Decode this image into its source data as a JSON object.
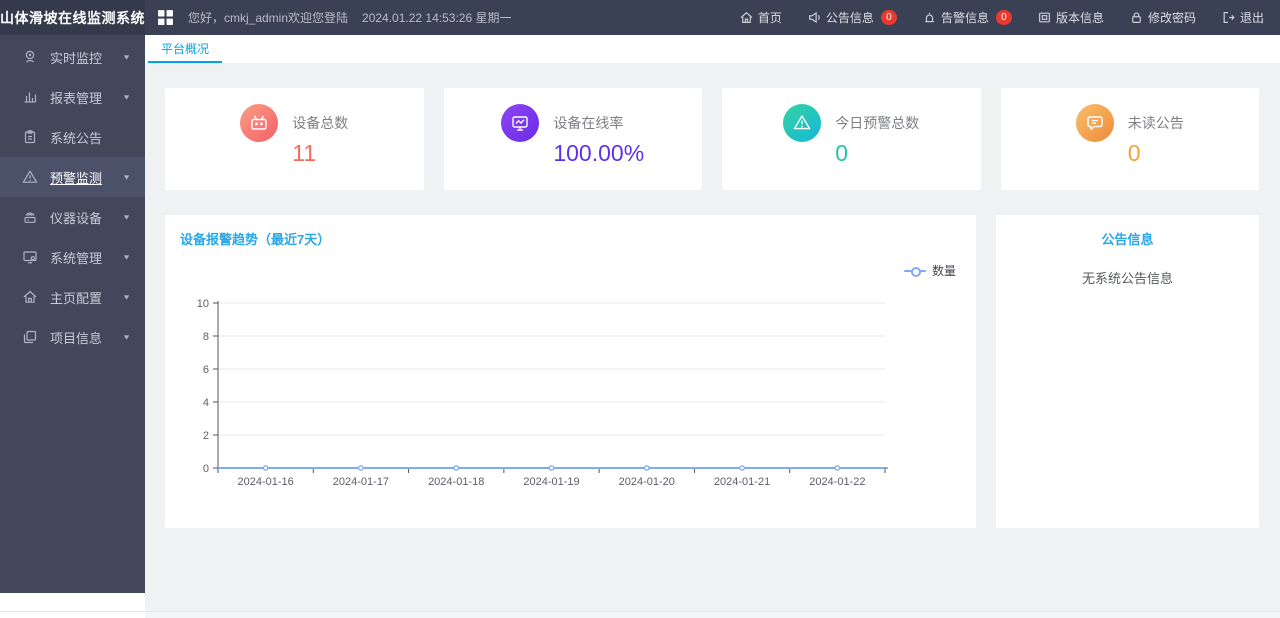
{
  "app": {
    "title": "山体滑坡在线监测系统"
  },
  "header": {
    "greeting": "您好，cmkj_admin欢迎您登陆",
    "datetime": "2024.01.22 14:53:26 星期一",
    "nav": [
      {
        "label": "首页",
        "icon": "home-icon"
      },
      {
        "label": "公告信息",
        "icon": "announcement-icon",
        "badge": "0"
      },
      {
        "label": "告警信息",
        "icon": "alarm-icon",
        "badge": "0"
      },
      {
        "label": "版本信息",
        "icon": "version-icon"
      },
      {
        "label": "修改密码",
        "icon": "password-icon"
      },
      {
        "label": "退出",
        "icon": "logout-icon"
      }
    ]
  },
  "sidebar": {
    "items": [
      {
        "label": "实时监控",
        "icon": "webcam-icon",
        "expandable": true,
        "active": false
      },
      {
        "label": "报表管理",
        "icon": "report-icon",
        "expandable": true,
        "active": false
      },
      {
        "label": "系统公告",
        "icon": "notice-icon",
        "expandable": false,
        "active": false
      },
      {
        "label": "预警监测",
        "icon": "warning-icon",
        "expandable": true,
        "active": true
      },
      {
        "label": "仪器设备",
        "icon": "instrument-icon",
        "expandable": true,
        "active": false
      },
      {
        "label": "系统管理",
        "icon": "system-icon",
        "expandable": true,
        "active": false
      },
      {
        "label": "主页配置",
        "icon": "homepage-icon",
        "expandable": true,
        "active": false
      },
      {
        "label": "项目信息",
        "icon": "project-icon",
        "expandable": true,
        "active": false
      }
    ]
  },
  "tabs": [
    {
      "label": "平台概况",
      "active": true
    }
  ],
  "stats": [
    {
      "label": "设备总数",
      "value": "11",
      "value_color": "#f56c5b",
      "icon": "device-total-icon",
      "icon_gradient": [
        "#fa9d85",
        "#f55f68"
      ]
    },
    {
      "label": "设备在线率",
      "value": "100.00%",
      "value_color": "#5f30f2",
      "icon": "online-rate-icon",
      "icon_gradient": [
        "#8d46f2",
        "#6a2be8"
      ]
    },
    {
      "label": "今日预警总数",
      "value": "0",
      "value_color": "#25c3a6",
      "icon": "today-warning-icon",
      "icon_gradient": [
        "#35d3a2",
        "#14b8d8"
      ]
    },
    {
      "label": "未读公告",
      "value": "0",
      "value_color": "#f2a33d",
      "icon": "unread-notice-icon",
      "icon_gradient": [
        "#f8c06a",
        "#ee8a3a"
      ]
    }
  ],
  "chart_data": {
    "type": "line",
    "title": "设备报警趋势（最近7天）",
    "categories": [
      "2024-01-16",
      "2024-01-17",
      "2024-01-18",
      "2024-01-19",
      "2024-01-20",
      "2024-01-21",
      "2024-01-22"
    ],
    "series": [
      {
        "name": "数量",
        "values": [
          0,
          0,
          0,
          0,
          0,
          0,
          0
        ]
      }
    ],
    "ylim": [
      0,
      10
    ],
    "ytick_step": 2,
    "grid": true,
    "legend_position": "top-right",
    "line_color": "#82aaf2",
    "axis_color": "#51555e",
    "grid_color": "#e8eaed",
    "label_color": "#5c5f66"
  },
  "announcement_panel": {
    "title": "公告信息",
    "empty_text": "无系统公告信息"
  }
}
